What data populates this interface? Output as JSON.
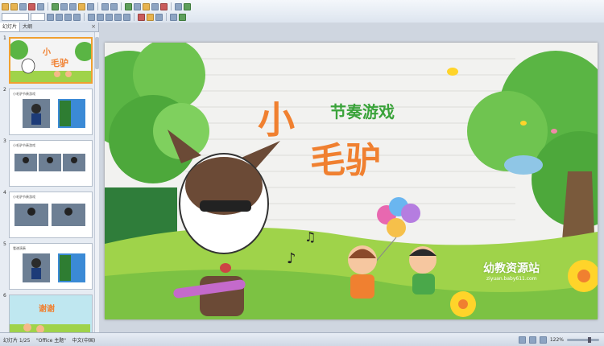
{
  "left_pane": {
    "tab_slides": "幻灯片",
    "tab_outline": "大纲",
    "close_glyph": "×",
    "slides": [
      {
        "num": "1",
        "title": "小毛驴"
      },
      {
        "num": "2",
        "title": "小毛驴节奏游戏"
      },
      {
        "num": "3",
        "title": "小毛驴节奏游戏"
      },
      {
        "num": "4",
        "title": "小毛驴节奏游戏"
      },
      {
        "num": "5",
        "title": "看谱演奏"
      },
      {
        "num": "6",
        "title": "谢谢"
      }
    ]
  },
  "slide": {
    "title_small": "节奏游戏",
    "title_char1": "小",
    "title_char2": "毛",
    "title_char3": "驴",
    "logo": "幼教资源站",
    "logo_url": "ziyuan.baby611.com",
    "music_note_1": "♪",
    "music_note_2": "♫"
  },
  "status": {
    "slide_info": "幻灯片 1/25",
    "theme": "\"Office 主题\"",
    "lang": "中文(中国)",
    "zoom": "122%"
  },
  "colors": {
    "title_orange": "#f08030",
    "title_green": "#3aa33a",
    "grass": "#9fd34a",
    "tree": "#5ab544",
    "selection": "#f0a030"
  }
}
